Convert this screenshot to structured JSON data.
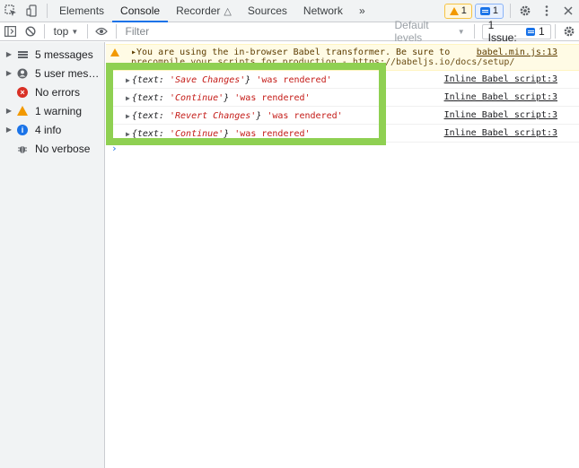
{
  "tabbar": {
    "tabs": [
      {
        "label": "Elements"
      },
      {
        "label": "Console"
      },
      {
        "label": "Recorder"
      },
      {
        "label": "Sources"
      },
      {
        "label": "Network"
      }
    ],
    "more": "»",
    "warning_count": "1",
    "issue_count": "1"
  },
  "toolbar": {
    "context": "top",
    "filter_placeholder": "Filter",
    "levels": "Default levels",
    "issue_label": "1 Issue:",
    "issue_count": "1"
  },
  "sidebar": {
    "items": [
      {
        "label": "5 messages",
        "icon": "list-icon"
      },
      {
        "label": "5 user mes…",
        "icon": "user-icon"
      },
      {
        "label": "No errors",
        "icon": "error-icon"
      },
      {
        "label": "1 warning",
        "icon": "warning-icon"
      },
      {
        "label": "4 info",
        "icon": "info-icon"
      },
      {
        "label": "No verbose",
        "icon": "bug-icon"
      }
    ]
  },
  "console": {
    "warning": {
      "line1": "▸You are using the in-browser Babel transformer. Be sure to",
      "line2": "precompile your scripts for production - https://babeljs.io/docs/setup/",
      "source": "babel.min.js:13",
      "link": "https://babeljs.io/docs/setup/"
    },
    "logs": [
      {
        "key": "{text: ",
        "value": "'Save Changes'",
        "close": "}",
        "msg": " 'was rendered'",
        "source": "Inline Babel script:3"
      },
      {
        "key": "{text: ",
        "value": "'Continue'",
        "close": "}",
        "msg": " 'was rendered'",
        "source": "Inline Babel script:3"
      },
      {
        "key": "{text: ",
        "value": "'Revert Changes'",
        "close": "}",
        "msg": " 'was rendered'",
        "source": "Inline Babel script:3"
      },
      {
        "key": "{text: ",
        "value": "'Continue'",
        "close": "}",
        "msg": " 'was rendered'",
        "source": "Inline Babel script:3"
      }
    ],
    "prompt": "›"
  },
  "colors": {
    "accent": "#1a73e8",
    "warning": "#f29900",
    "error": "#d93025",
    "string": "#c41a16",
    "highlight": "#8fd052"
  }
}
